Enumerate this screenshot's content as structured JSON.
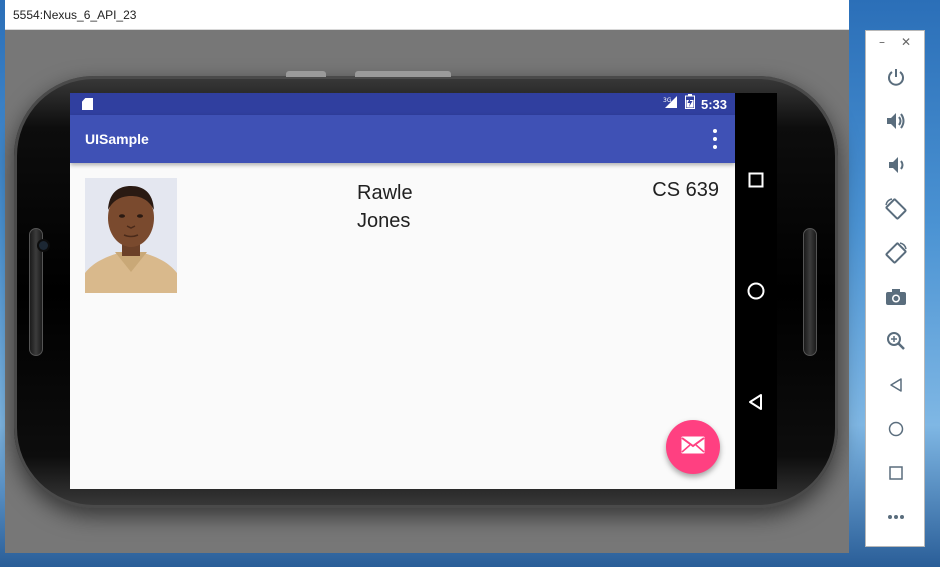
{
  "window": {
    "title": "5554:Nexus_6_API_23"
  },
  "status_bar": {
    "network": "3G",
    "time": "5:33"
  },
  "app_bar": {
    "title": "UISample"
  },
  "content": {
    "name_line1": "Rawle",
    "name_line2": "Jones",
    "course": "CS 639"
  },
  "colors": {
    "status_bar": "#303f9f",
    "app_bar": "#3f51b5",
    "fab": "#ff4081",
    "background": "#fafafa"
  },
  "icons": {
    "fab": "email-icon",
    "nav": [
      "recent-apps-icon",
      "home-icon",
      "back-icon"
    ],
    "toolbar": [
      "power-icon",
      "volume-up-icon",
      "volume-down-icon",
      "rotate-left-icon",
      "rotate-right-icon",
      "camera-icon",
      "zoom-icon",
      "back-icon",
      "home-icon",
      "overview-icon",
      "more-icon"
    ]
  }
}
